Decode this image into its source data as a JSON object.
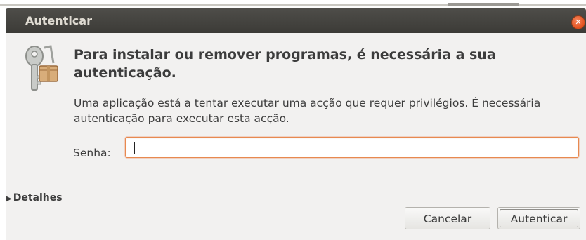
{
  "window": {
    "title": "Autenticar",
    "close_icon": "close-icon"
  },
  "dialog": {
    "icon": "keys-package-icon",
    "heading": "Para instalar ou remover programas, é necessária a sua autenticação.",
    "description": "Uma aplicação está a tentar executar uma acção que requer privilégios. É necessária autenticação para executar esta acção.",
    "password_label": "Senha:",
    "password_value": "",
    "details_label": "Detalhes",
    "cancel_label": "Cancelar",
    "authenticate_label": "Autenticar"
  },
  "colors": {
    "titlebar": "#3c3b37",
    "accent": "#e95420",
    "dialog_bg": "#f2f1f0"
  }
}
